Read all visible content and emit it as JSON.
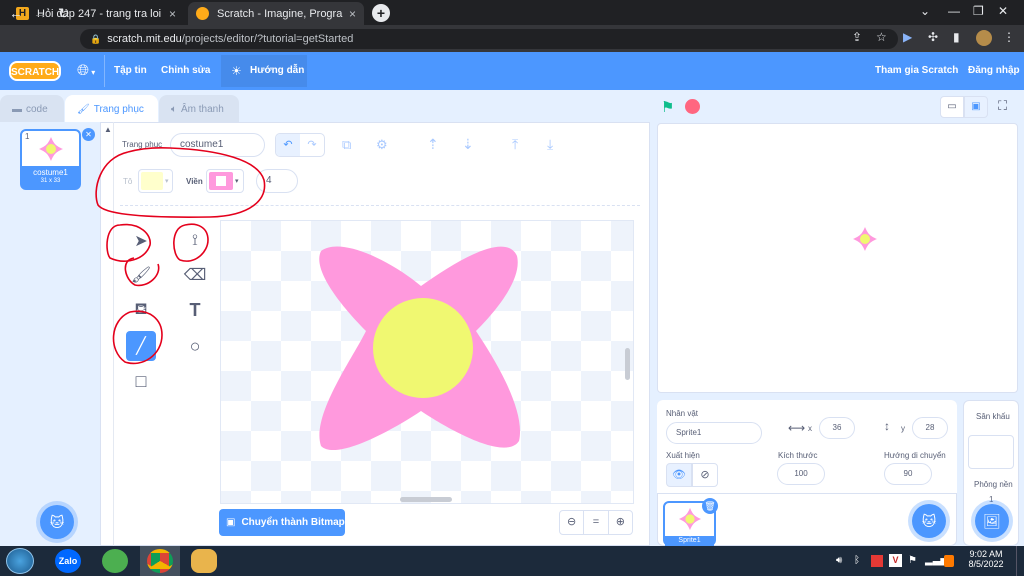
{
  "browser": {
    "tabs": [
      {
        "title": "Hỏi đáp 247 - trang tra loi",
        "close": "×"
      },
      {
        "title": "Scratch - Imagine, Program, Shar",
        "close": "×"
      }
    ],
    "new_tab": "+",
    "url_host": "scratch.mit.edu",
    "url_path": "/projects/editor/?tutorial=getStarted"
  },
  "scratch": {
    "logo": "SCRATCH",
    "menu": {
      "file": "Tập tin",
      "edit": "Chỉnh sửa",
      "tutorials": "Hướng dẫn",
      "join": "Tham gia Scratch",
      "signin": "Đăng nhập"
    },
    "tabs": {
      "code": "code",
      "costumes": "Trang phục",
      "sounds": "Âm thanh"
    },
    "costume_list": [
      {
        "index": "1",
        "name": "costume1",
        "size": "31 x 33"
      }
    ],
    "paint": {
      "costume_label": "Trang phục",
      "costume_name": "costume1",
      "fill_label": "Tô",
      "outline_label": "Viền",
      "outline_width": "4",
      "fill_color": "#ffffcc",
      "outline_color": "#ff99dd",
      "convert_button": "Chuyển thành Bitmap",
      "zoom_reset": "="
    },
    "sprite": {
      "label": "Nhân vật",
      "name": "Sprite1",
      "x_label": "x",
      "x": "36",
      "y_label": "y",
      "y": "28",
      "show_label": "Xuất hiện",
      "size_label": "Kích thước",
      "size": "100",
      "direction_label": "Hướng di chuyển",
      "direction": "90",
      "tile_name": "Sprite1"
    },
    "stage": {
      "label": "Sân khấu",
      "backdrops_label": "Phông nền",
      "backdrops_count": "1"
    }
  },
  "taskbar": {
    "time": "9:02 AM",
    "date": "8/5/2022",
    "zalo": "Zalo"
  },
  "colors": {
    "scratch_blue": "#4c97ff",
    "petal": "#ff99dd",
    "center": "#f0f871",
    "annotation_red": "#e4001c"
  }
}
